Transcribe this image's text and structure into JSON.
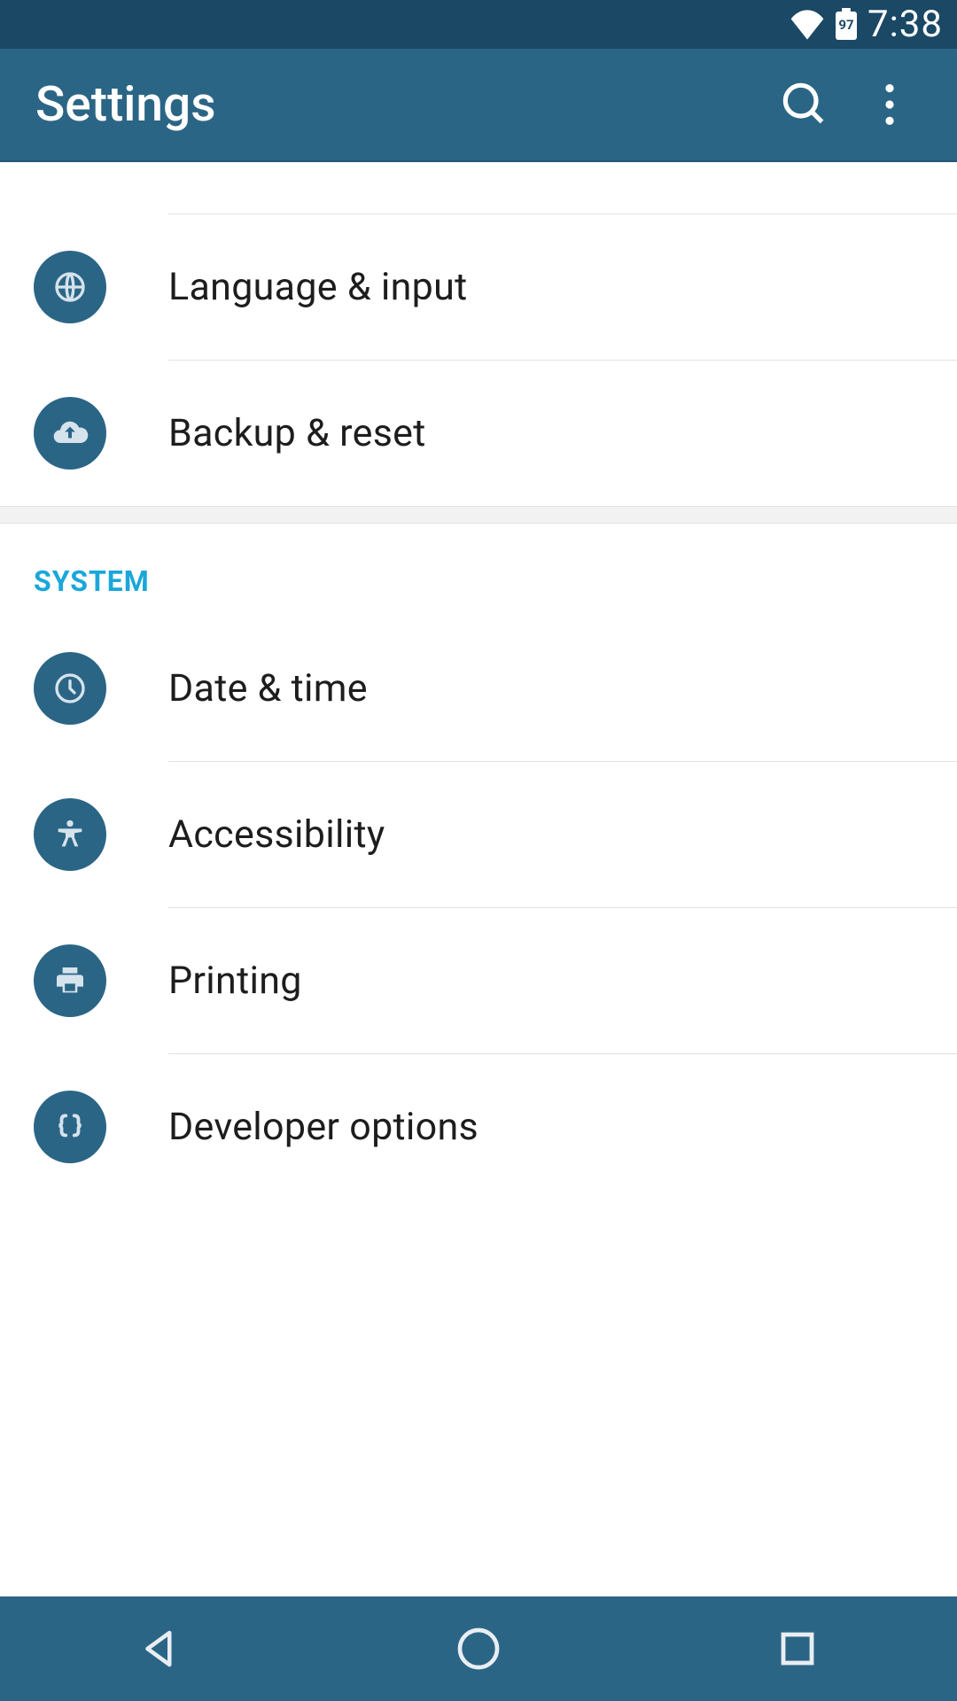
{
  "status": {
    "battery_pct": "97",
    "time": "7:38"
  },
  "appbar": {
    "title": "Settings"
  },
  "sections": {
    "personal": {
      "language_input": "Language & input",
      "backup_reset": "Backup & reset"
    },
    "system": {
      "header": "SYSTEM",
      "date_time": "Date & time",
      "accessibility": "Accessibility",
      "printing": "Printing",
      "developer_options": "Developer options"
    }
  },
  "colors": {
    "status_bar": "#1a4865",
    "app_bar": "#2b6586",
    "icon_circle": "#2b6586",
    "section_header": "#1aa7d9"
  }
}
